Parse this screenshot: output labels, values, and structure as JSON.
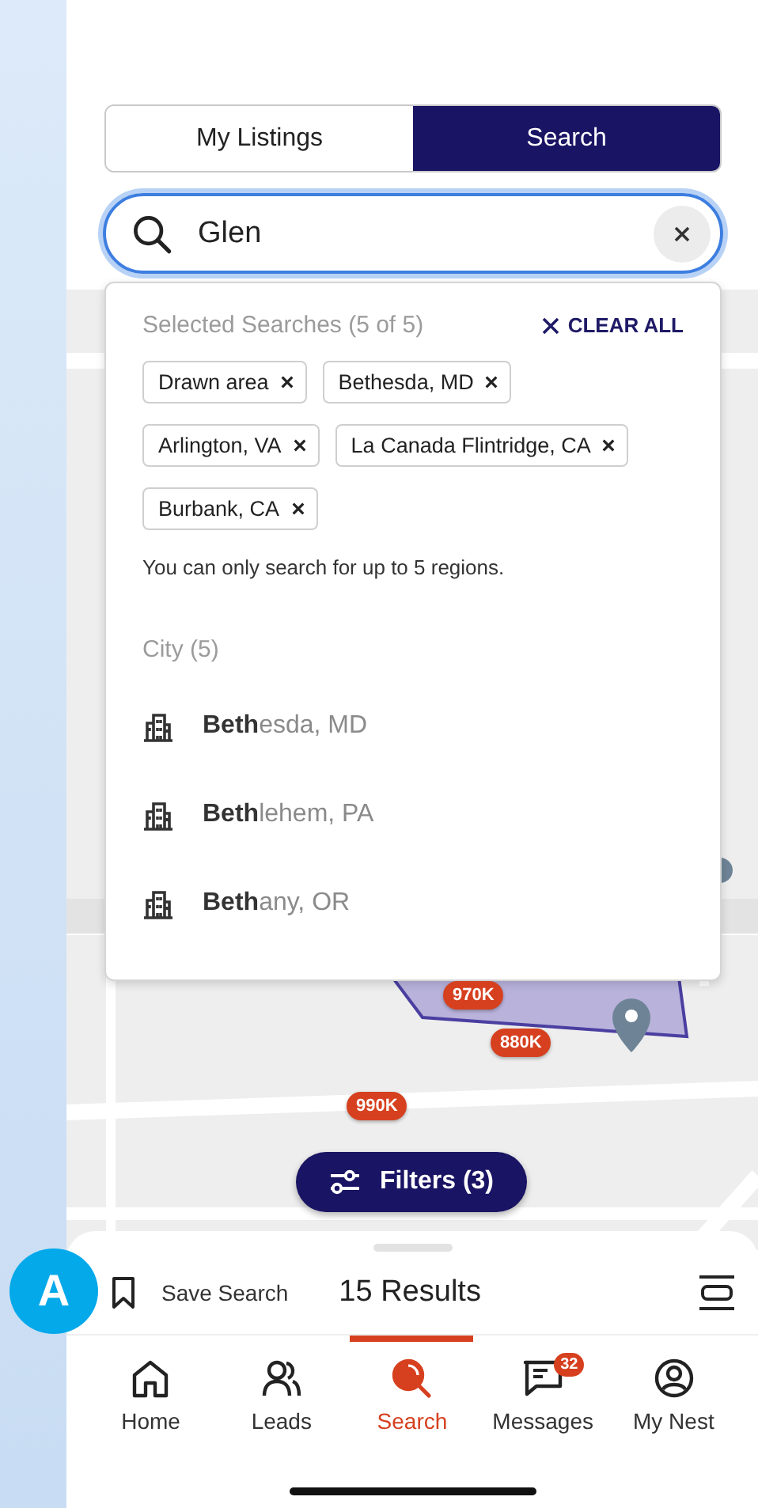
{
  "tabs": [
    {
      "label": "My Listings",
      "selected": false
    },
    {
      "label": "Search",
      "selected": true
    }
  ],
  "search": {
    "value": "Glen"
  },
  "dropdown": {
    "selected_title": "Selected Searches (5 of 5)",
    "clear_all": "CLEAR ALL",
    "chips": [
      {
        "label": "Drawn area"
      },
      {
        "label": "Bethesda, MD"
      },
      {
        "label": "Arlington, VA"
      },
      {
        "label": "La Canada Flintridge, CA"
      },
      {
        "label": "Burbank, CA"
      }
    ],
    "limit_note": "You can only search for up to 5 regions.",
    "group_title": "City (5)",
    "results": [
      {
        "label": "**Beth**esda, MD"
      },
      {
        "label": "**Beth**lehem, PA"
      },
      {
        "label": "**Beth**any, OR"
      }
    ]
  },
  "map_pins": [
    {
      "label": "970K"
    },
    {
      "label": "880K"
    },
    {
      "label": "990K"
    }
  ],
  "filters_button": "Filters (3)",
  "annotation_badge": "A",
  "sheet": {
    "save_search": "Save Search",
    "results_count": "15 Results"
  },
  "nav": [
    {
      "kind": "home",
      "label": "Home",
      "selected": false
    },
    {
      "kind": "leads",
      "label": "Leads",
      "selected": false
    },
    {
      "kind": "search",
      "label": "Search",
      "selected": true
    },
    {
      "kind": "messages",
      "label": "Messages",
      "selected": false,
      "badge": "32"
    },
    {
      "kind": "profile",
      "label": "My Nest",
      "selected": false
    }
  ]
}
